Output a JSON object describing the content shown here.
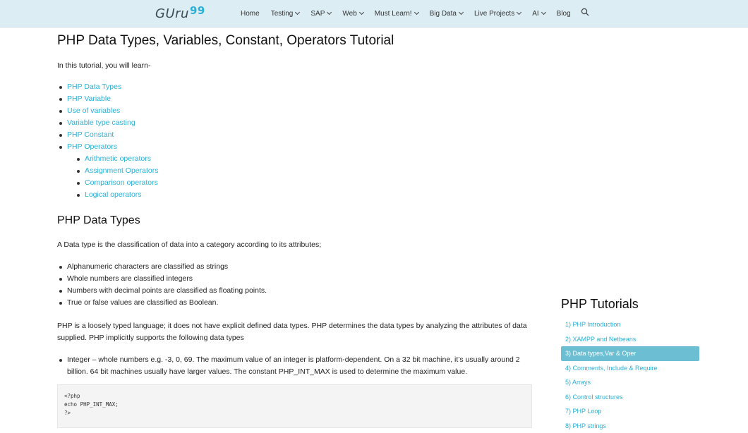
{
  "header": {
    "logo_word": "GUru",
    "logo_num": "99",
    "nav": [
      {
        "label": "Home",
        "dropdown": false
      },
      {
        "label": "Testing",
        "dropdown": true
      },
      {
        "label": "SAP",
        "dropdown": true
      },
      {
        "label": "Web",
        "dropdown": true
      },
      {
        "label": "Must Learn!",
        "dropdown": true
      },
      {
        "label": "Big Data",
        "dropdown": true
      },
      {
        "label": "Live Projects",
        "dropdown": true
      },
      {
        "label": "AI",
        "dropdown": true
      },
      {
        "label": "Blog",
        "dropdown": false
      }
    ],
    "search_icon": "search-icon"
  },
  "main": {
    "title": "PHP Data Types, Variables, Constant, Operators Tutorial",
    "intro": "In this tutorial, you will learn-",
    "toc": [
      "PHP Data Types",
      "PHP Variable",
      "Use of variables",
      "Variable type casting",
      "PHP Constant",
      "PHP Operators"
    ],
    "toc_sub": [
      "Arithmetic operators",
      "Assignment Operators",
      "Comparison operators",
      "Logical operators"
    ],
    "section_heading": "PHP Data Types",
    "section_intro": "A Data type is the classification of data into a category according to its attributes;",
    "bullets": [
      "Alphanumeric characters are classified as strings",
      "Whole numbers are classified integers",
      "Numbers with decimal points are classified as floating points.",
      "True or false values are classified as Boolean."
    ],
    "para": "PHP is a loosely typed language; it does not have explicit defined data types. PHP determines the data types by analyzing the attributes of data supplied. PHP implicitly supports the following data types",
    "integer_bullet": "Integer – whole numbers e.g. -3, 0, 69. The maximum value of an integer is platform-dependent. On a 32 bit machine, it’s usually around 2 billion. 64 bit machines usually have larger values. The constant PHP_INT_MAX is used to determine the maximum value.",
    "code_lines": [
      "<?php",
      "echo PHP_INT_MAX;",
      "?>"
    ]
  },
  "sidebar": {
    "title": "PHP Tutorials",
    "items": [
      {
        "label": "1) PHP Introduction",
        "active": false
      },
      {
        "label": "2) XAMPP and Netbeans",
        "active": false
      },
      {
        "label": "3) Data types,Var & Oper",
        "active": true
      },
      {
        "label": "4) Comments, Include & Require",
        "active": false
      },
      {
        "label": "5) Arrays",
        "active": false
      },
      {
        "label": "6) Control structures",
        "active": false
      },
      {
        "label": "7) PHP Loop",
        "active": false
      },
      {
        "label": "8) PHP strings",
        "active": false
      }
    ]
  },
  "colors": {
    "accent": "#2bb0d8",
    "header_bg": "#dcedf4",
    "active_item_bg": "#6cbfd2"
  }
}
